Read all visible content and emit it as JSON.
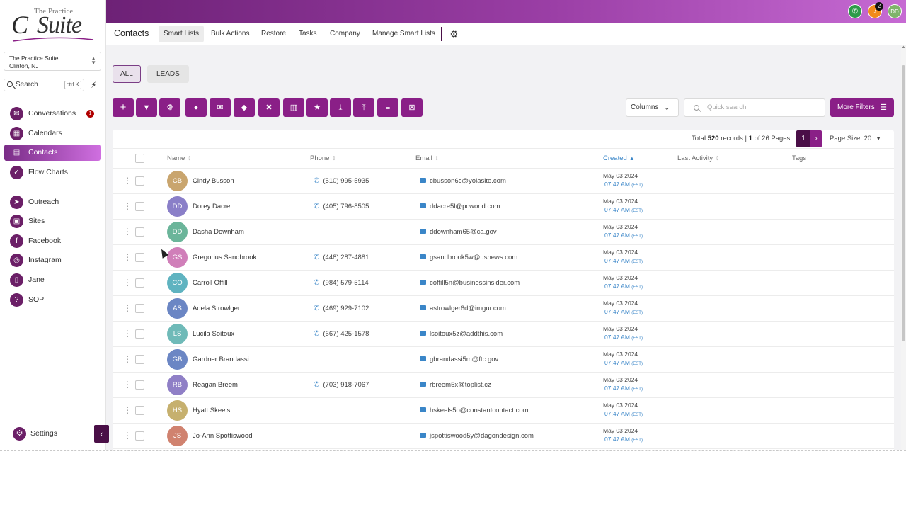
{
  "brand": {
    "line1": "The Practice",
    "line2": "Suite",
    "initial": "C"
  },
  "account": {
    "name": "The Practice Suite",
    "location": "Clinton, NJ"
  },
  "search": {
    "label": "Search",
    "shortcut": "ctrl K"
  },
  "sidebar": {
    "items": [
      {
        "label": "Conversations",
        "icon": "chat-icon",
        "badge": "1"
      },
      {
        "label": "Calendars",
        "icon": "calendar-icon"
      },
      {
        "label": "Contacts",
        "icon": "contacts-icon",
        "active": true
      },
      {
        "label": "Flow Charts",
        "icon": "flowchart-icon"
      },
      {
        "label": "Outreach",
        "icon": "send-icon"
      },
      {
        "label": "Sites",
        "icon": "sites-icon"
      },
      {
        "label": "Facebook",
        "icon": "facebook-icon"
      },
      {
        "label": "Instagram",
        "icon": "instagram-icon"
      },
      {
        "label": "Jane",
        "icon": "phone-device-icon"
      },
      {
        "label": "SOP",
        "icon": "help-icon"
      }
    ],
    "settings_label": "Settings"
  },
  "topbar": {
    "notifications_count": "2",
    "user_initials": "DD"
  },
  "subnav": {
    "title": "Contacts",
    "tabs": [
      "Smart Lists",
      "Bulk Actions",
      "Restore",
      "Tasks",
      "Company",
      "Manage Smart Lists"
    ]
  },
  "filters": {
    "all": "ALL",
    "leads": "LEADS"
  },
  "toolbar": {
    "columns_label": "Columns",
    "quick_search_placeholder": "Quick search",
    "more_filters_label": "More Filters"
  },
  "pagination": {
    "total_prefix": "Total",
    "total": "520",
    "records_label": "records |",
    "page": "1",
    "of_pages": "of 26 Pages",
    "page_size_label": "Page Size: 20"
  },
  "table": {
    "headers": {
      "name": "Name",
      "phone": "Phone",
      "email": "Email",
      "created": "Created",
      "last_activity": "Last Activity",
      "tags": "Tags"
    },
    "rows": [
      {
        "initials": "CB",
        "name": "Cindy Busson",
        "phone": "(510) 995-5935",
        "email": "cbusson6c@yolasite.com",
        "date": "May 03 2024",
        "time": "07:47 AM",
        "tz": "(EST)",
        "color": "#c9a56e"
      },
      {
        "initials": "DD",
        "name": "Dorey Dacre",
        "phone": "(405) 796-8505",
        "email": "ddacre5l@pcworld.com",
        "date": "May 03 2024",
        "time": "07:47 AM",
        "tz": "(EST)",
        "color": "#8a7fc8"
      },
      {
        "initials": "DD",
        "name": "Dasha Downham",
        "phone": "",
        "email": "ddownham65@ca.gov",
        "date": "May 03 2024",
        "time": "07:47 AM",
        "tz": "(EST)",
        "color": "#6bb59a"
      },
      {
        "initials": "GS",
        "name": "Gregorius Sandbrook",
        "phone": "(448) 287-4881",
        "email": "gsandbrook5w@usnews.com",
        "date": "May 03 2024",
        "time": "07:47 AM",
        "tz": "(EST)",
        "color": "#d07fb9"
      },
      {
        "initials": "CO",
        "name": "Carroll Offill",
        "phone": "(984) 579-5114",
        "email": "coffill5n@businessinsider.com",
        "date": "May 03 2024",
        "time": "07:47 AM",
        "tz": "(EST)",
        "color": "#5fb3c0"
      },
      {
        "initials": "AS",
        "name": "Adela Strowlger",
        "phone": "(469) 929-7102",
        "email": "astrowlger6d@imgur.com",
        "date": "May 03 2024",
        "time": "07:47 AM",
        "tz": "(EST)",
        "color": "#6b86c4"
      },
      {
        "initials": "LS",
        "name": "Lucila Soitoux",
        "phone": "(667) 425-1578",
        "email": "lsoitoux5z@addthis.com",
        "date": "May 03 2024",
        "time": "07:47 AM",
        "tz": "(EST)",
        "color": "#6fbab8"
      },
      {
        "initials": "GB",
        "name": "Gardner Brandassi",
        "phone": "",
        "email": "gbrandassi5m@ftc.gov",
        "date": "May 03 2024",
        "time": "07:47 AM",
        "tz": "(EST)",
        "color": "#6b86c4"
      },
      {
        "initials": "RB",
        "name": "Reagan Breem",
        "phone": "(703) 918-7067",
        "email": "rbreem5x@toplist.cz",
        "date": "May 03 2024",
        "time": "07:47 AM",
        "tz": "(EST)",
        "color": "#8f7fc6"
      },
      {
        "initials": "HS",
        "name": "Hyatt Skeels",
        "phone": "",
        "email": "hskeels5o@constantcontact.com",
        "date": "May 03 2024",
        "time": "07:47 AM",
        "tz": "(EST)",
        "color": "#c6b06e"
      },
      {
        "initials": "JS",
        "name": "Jo-Ann Spottiswood",
        "phone": "",
        "email": "jspottiswood5y@dagondesign.com",
        "date": "May 03 2024",
        "time": "07:47 AM",
        "tz": "(EST)",
        "color": "#d0826f"
      }
    ]
  },
  "colors": {
    "brand_dark": "#4a0f47",
    "brand": "#8a1f87",
    "link": "#3a86c8"
  }
}
